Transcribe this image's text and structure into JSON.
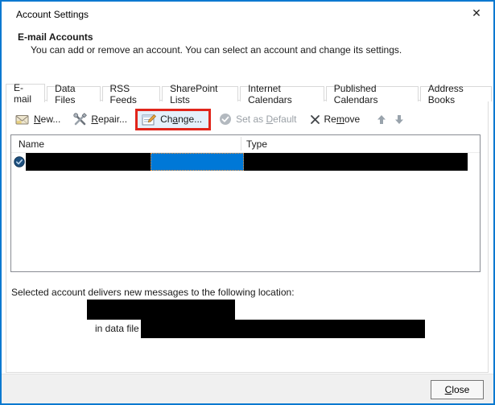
{
  "window": {
    "title": "Account Settings",
    "close_glyph": "✕"
  },
  "header": {
    "title": "E-mail Accounts",
    "description": "You can add or remove an account. You can select an account and change its settings."
  },
  "tabs": [
    {
      "label": "E-mail",
      "active": true
    },
    {
      "label": "Data Files",
      "active": false
    },
    {
      "label": "RSS Feeds",
      "active": false
    },
    {
      "label": "SharePoint Lists",
      "active": false
    },
    {
      "label": "Internet Calendars",
      "active": false
    },
    {
      "label": "Published Calendars",
      "active": false
    },
    {
      "label": "Address Books",
      "active": false
    }
  ],
  "toolbar": {
    "new": {
      "pre": "",
      "key": "N",
      "post": "ew..."
    },
    "repair": {
      "pre": "",
      "key": "R",
      "post": "epair..."
    },
    "change": {
      "pre": "Ch",
      "key": "a",
      "post": "nge..."
    },
    "set_default": {
      "pre": "Set as ",
      "key": "D",
      "post": "efault"
    },
    "remove": {
      "pre": "Re",
      "key": "m",
      "post": "ove"
    }
  },
  "account_list": {
    "columns": {
      "name": "Name",
      "type": "Type"
    },
    "selected_row": {
      "is_default_account": true,
      "name_redacted": true,
      "type_redacted": true
    }
  },
  "info": {
    "delivery_text": "Selected account delivers new messages to the following location:",
    "data_file_label": "in data file",
    "location_redacted": true,
    "data_file_redacted": true
  },
  "footer": {
    "close": {
      "pre": "",
      "key": "C",
      "post": "lose"
    }
  },
  "icons": {
    "close": "x-mark",
    "new_account": "envelope",
    "repair": "crossed-tools",
    "change": "form-with-pencil",
    "set_default": "check-circle-gray",
    "remove": "x-mark-black",
    "move_up": "arrow-up",
    "move_down": "arrow-down",
    "default_account": "blue-circle-check"
  },
  "colors": {
    "window_border": "#0b79d0",
    "selection": "#0078d7",
    "annotation_red": "#e1251b",
    "redaction": "#000000",
    "footer_bg": "#f0f0f0"
  }
}
